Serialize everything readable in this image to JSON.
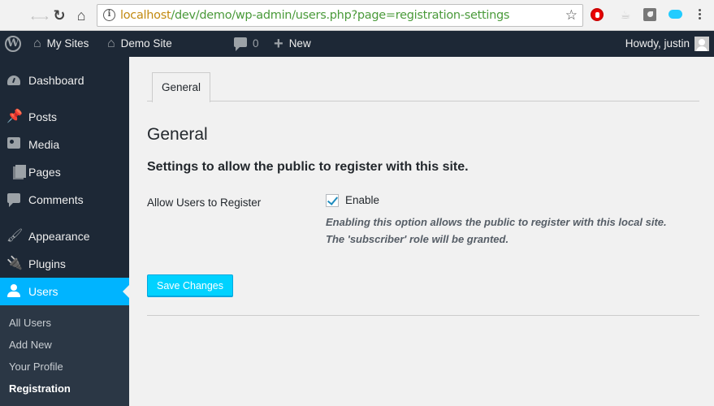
{
  "browser": {
    "url_host": "localhost",
    "url_path": "/dev/demo/wp-admin/users.php?page=registration-settings",
    "extensions": [
      "stop-hand-icon",
      "java-icon",
      "gray-extension-icon",
      "cloud-icon"
    ]
  },
  "adminbar": {
    "my_sites": "My Sites",
    "site_name": "Demo Site",
    "comments_count": "0",
    "new_label": "New",
    "howdy": "Howdy, justin"
  },
  "sidebar": {
    "items": [
      {
        "label": "Dashboard",
        "icon": "dashboard-icon"
      },
      {
        "label": "Posts",
        "icon": "pin-icon"
      },
      {
        "label": "Media",
        "icon": "media-icon"
      },
      {
        "label": "Pages",
        "icon": "pages-icon"
      },
      {
        "label": "Comments",
        "icon": "comments-icon"
      },
      {
        "label": "Appearance",
        "icon": "paintbrush-icon"
      },
      {
        "label": "Plugins",
        "icon": "plugin-icon"
      },
      {
        "label": "Users",
        "icon": "users-icon",
        "current": true
      }
    ],
    "submenu": [
      {
        "label": "All Users"
      },
      {
        "label": "Add New"
      },
      {
        "label": "Your Profile"
      },
      {
        "label": "Registration",
        "current": true
      }
    ]
  },
  "main": {
    "tabs": [
      {
        "label": "General",
        "active": true
      }
    ],
    "section_title": "General",
    "section_subtitle": "Settings to allow the public to register with this site.",
    "field_label": "Allow Users to Register",
    "checkbox_label": "Enable",
    "checkbox_checked": true,
    "description_line1": "Enabling this option allows the public to register with this local site.",
    "description_line2": "The 'subscriber' role will be granted.",
    "save_label": "Save Changes"
  },
  "colors": {
    "adminbar_bg": "#1d2836",
    "accent": "#00b4ff",
    "button": "#00d2ff"
  }
}
